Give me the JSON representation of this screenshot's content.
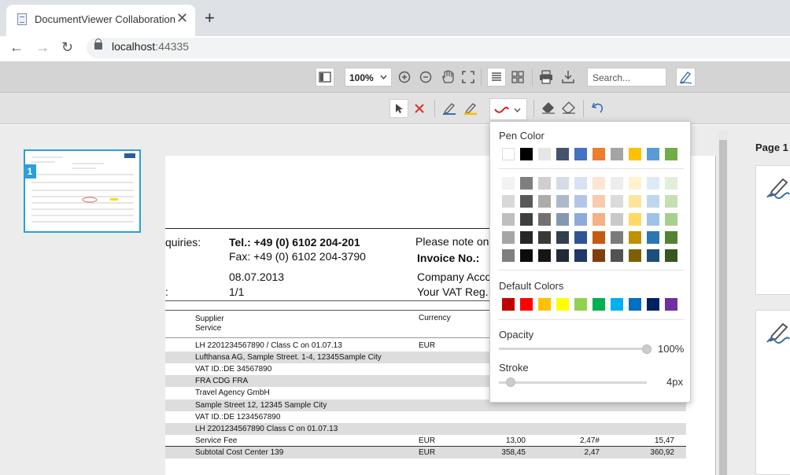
{
  "browser": {
    "tab_title": "DocumentViewer Collaboration",
    "close_glyph": "✕",
    "newtab_glyph": "+",
    "url_host": "localhost",
    "url_port": ":44335",
    "back": "←",
    "forward": "→",
    "reload": "↻"
  },
  "toolbar": {
    "zoom": "100%",
    "search_placeholder": "Search..."
  },
  "thumbnail": {
    "page_number": "1"
  },
  "right_panel": {
    "page_label": "Page 1"
  },
  "invoice": {
    "enquiries": "quiries:",
    "tel": "Tel.:  +49 (0) 6102 204-201",
    "fax": "Fax:  +49 (0) 6102 204-3790",
    "date": "08.07.2013",
    "page": "1/1",
    "colon": ":",
    "note": "Please note on a",
    "invoice_no": "Invoice No.:",
    "company_acc": "Company Accou",
    "vat_reg": "Your VAT Reg. N",
    "col_supplier": "Supplier",
    "col_service": "Service",
    "col_currency": "Currency",
    "rows": [
      {
        "label": "LH 2201234567890 / Class C on 01.07.13",
        "currency": "EUR",
        "c1": "",
        "c2": "",
        "c3": ""
      },
      {
        "label": "Lufthansa AG, Sample Street. 1-4, 12345Sample City",
        "currency": "",
        "c1": "",
        "c2": "",
        "c3": ""
      },
      {
        "label": "VAT ID.:DE 34567890",
        "currency": "",
        "c1": "",
        "c2": "",
        "c3": ""
      },
      {
        "label": "FRA CDG FRA",
        "currency": "",
        "c1": "",
        "c2": "",
        "c3": ""
      },
      {
        "label": "Travel Agency GmbH",
        "currency": "",
        "c1": "",
        "c2": "",
        "c3": ""
      },
      {
        "label": "Sample Street 12, 12345 Sample City",
        "currency": "",
        "c1": "",
        "c2": "",
        "c3": ""
      },
      {
        "label": "VAT ID.:DE 1234567890",
        "currency": "",
        "c1": "",
        "c2": "",
        "c3": ""
      },
      {
        "label": "LH 2201234567890 Class C on 01.07.13",
        "currency": "",
        "c1": "",
        "c2": "",
        "c3": ""
      },
      {
        "label": "Service Fee",
        "currency": "EUR",
        "c1": "13,00",
        "c2": "2,47#",
        "c3": "15,47"
      },
      {
        "label": "Subtotal Cost Center 139",
        "currency": "EUR",
        "c1": "358,45",
        "c2": "2,47",
        "c3": "360,92"
      }
    ]
  },
  "pen_popup": {
    "pen_color_title": "Pen Color",
    "default_colors_title": "Default Colors",
    "opacity_title": "Opacity",
    "opacity_value": "100%",
    "opacity_level": 1.0,
    "stroke_title": "Stroke",
    "stroke_value": "4px",
    "stroke_level": 0.05,
    "theme_row": [
      "#ffffff",
      "#000000",
      "#e7e6e6",
      "#44546a",
      "#4472c4",
      "#ed7d31",
      "#a5a5a5",
      "#ffc000",
      "#5b9bd5",
      "#70ad47"
    ],
    "shades": [
      [
        "#f2f2f2",
        "#7f7f7f",
        "#d0cece",
        "#d6dce4",
        "#d9e2f3",
        "#fbe5d5",
        "#ededed",
        "#fff2cc",
        "#deebf6",
        "#e2efd9"
      ],
      [
        "#d8d8d8",
        "#595959",
        "#aeabab",
        "#adb9ca",
        "#b4c6e7",
        "#f7cbac",
        "#dbdbdb",
        "#fee599",
        "#bdd7ee",
        "#c5e0b3"
      ],
      [
        "#bfbfbf",
        "#3f3f3f",
        "#757070",
        "#8496b0",
        "#8eaadb",
        "#f4b183",
        "#c9c9c9",
        "#ffd965",
        "#9dc3e6",
        "#a8d08d"
      ],
      [
        "#a5a5a5",
        "#262626",
        "#3a3838",
        "#323f4f",
        "#2f5496",
        "#c55a11",
        "#7b7b7b",
        "#bf9000",
        "#2e75b5",
        "#538135"
      ],
      [
        "#7f7f7f",
        "#0c0c0c",
        "#171616",
        "#222a35",
        "#1f3864",
        "#833c0b",
        "#525252",
        "#7f6000",
        "#1e4e79",
        "#375623"
      ]
    ],
    "defaults": [
      "#c00000",
      "#ff0000",
      "#ffc000",
      "#ffff00",
      "#92d050",
      "#00b050",
      "#00b0f0",
      "#0070c0",
      "#002060",
      "#7030a0"
    ]
  }
}
